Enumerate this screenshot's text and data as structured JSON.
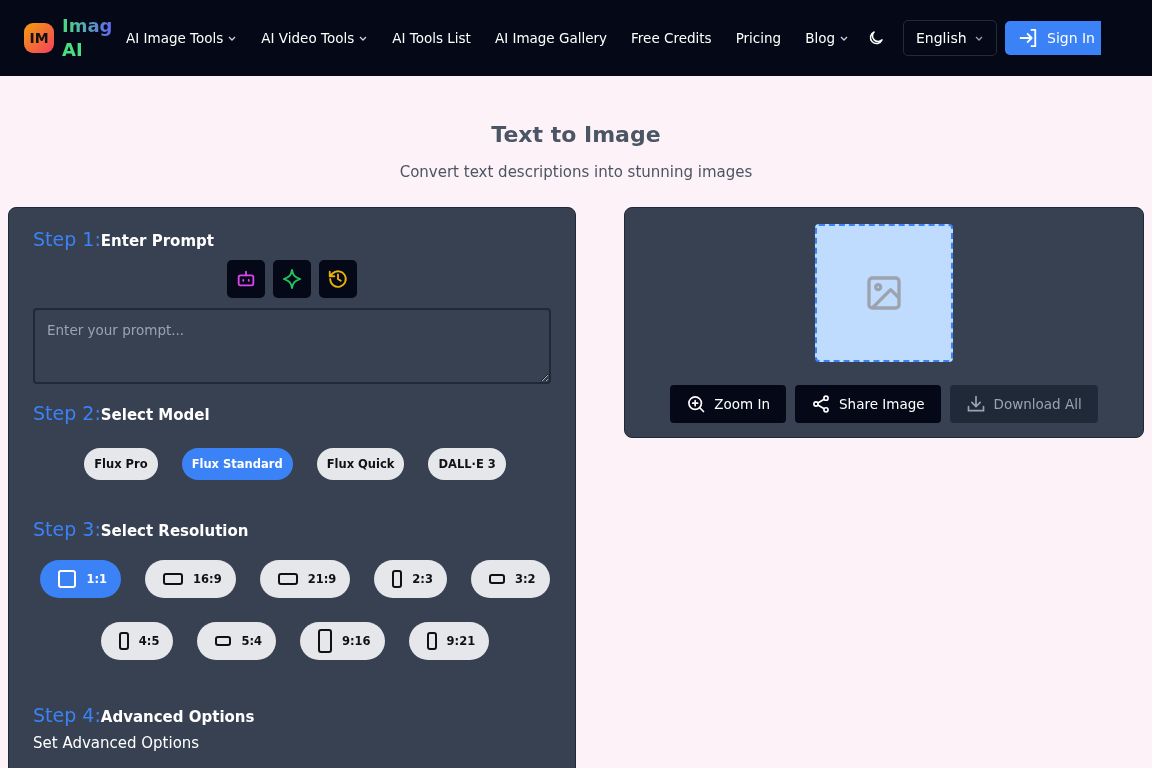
{
  "header": {
    "logo_mark": "IM",
    "logo_text": [
      "Imag",
      "AI"
    ],
    "nav": [
      {
        "label": "AI Image Tools",
        "dropdown": true
      },
      {
        "label": "AI Video Tools",
        "dropdown": true
      },
      {
        "label": "AI Tools List",
        "dropdown": false
      },
      {
        "label": "AI Image Gallery",
        "dropdown": false
      },
      {
        "label": "Free Credits",
        "dropdown": false
      },
      {
        "label": "Pricing",
        "dropdown": false
      },
      {
        "label": "Blog",
        "dropdown": true
      }
    ],
    "language": "English",
    "sign_in": "Sign In"
  },
  "title": "Text to Image",
  "subtitle": "Convert text descriptions into stunning images",
  "steps": [
    {
      "kind": "prompt",
      "number": "Step 1:",
      "label": "Enter Prompt",
      "placeholder": "Enter your prompt..."
    },
    {
      "kind": "model",
      "number": "Step 2:",
      "label": "Select Model",
      "options": [
        {
          "label": "Flux Pro",
          "selected": false
        },
        {
          "label": "Flux Standard",
          "selected": true
        },
        {
          "label": "Flux Quick",
          "selected": false
        },
        {
          "label": "DALL·E 3",
          "selected": false
        }
      ]
    },
    {
      "kind": "resolution",
      "number": "Step 3:",
      "label": "Select Resolution",
      "rows": [
        [
          {
            "label": "1:1",
            "kind": "square",
            "selected": true
          },
          {
            "label": "16:9",
            "kind": "wide",
            "selected": false
          },
          {
            "label": "21:9",
            "kind": "wide",
            "selected": false
          },
          {
            "label": "2:3",
            "kind": "portrait",
            "selected": false
          },
          {
            "label": "3:2",
            "kind": "landscape",
            "selected": false
          }
        ],
        [
          {
            "label": "4:5",
            "kind": "portrait",
            "selected": false
          },
          {
            "label": "5:4",
            "kind": "landscape",
            "selected": false
          },
          {
            "label": "9:16",
            "kind": "tall",
            "selected": false
          },
          {
            "label": "9:21",
            "kind": "portrait",
            "selected": false
          }
        ]
      ]
    },
    {
      "kind": "advanced",
      "number": "Step 4:",
      "label": "Advanced Options",
      "note": "Set Advanced Options"
    }
  ],
  "preview": {
    "actions": [
      {
        "label": "Zoom In",
        "kind": "zoom",
        "disabled": false
      },
      {
        "label": "Share Image",
        "kind": "share",
        "disabled": false
      },
      {
        "label": "Download All",
        "kind": "download",
        "disabled": true
      }
    ]
  }
}
